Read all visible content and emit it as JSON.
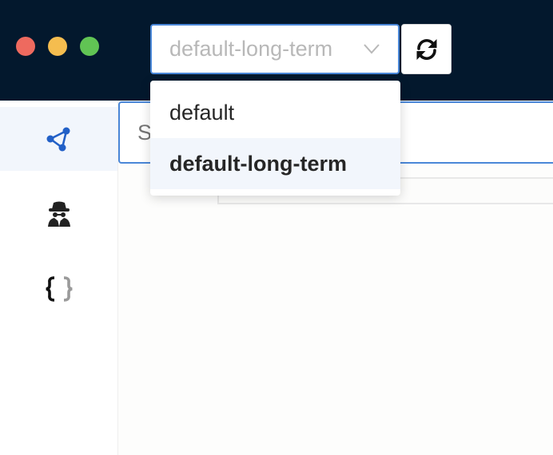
{
  "window": {
    "traffic_lights": {
      "close": "#ee6a5f",
      "minimize": "#f5bd4f",
      "zoom": "#61c454"
    }
  },
  "toolbar": {
    "environment_select": {
      "value": "default-long-term",
      "icon": "chevron-down-icon"
    },
    "refresh_button": {
      "icon": "refresh-icon"
    }
  },
  "sidebar": {
    "items": [
      {
        "icon": "share-nodes-icon",
        "active": true
      },
      {
        "icon": "spy-icon",
        "active": false
      },
      {
        "icon": "curly-braces-icon",
        "active": false
      }
    ]
  },
  "main": {
    "search": {
      "placeholder": "S"
    }
  },
  "dropdown": {
    "options": [
      {
        "label": "default",
        "selected": false
      },
      {
        "label": "default-long-term",
        "selected": true
      }
    ]
  },
  "colors": {
    "titlebar": "#03182d",
    "accent": "#4a87d8",
    "selected_bg": "#f2f6fc",
    "icon_blue": "#2260c7"
  }
}
